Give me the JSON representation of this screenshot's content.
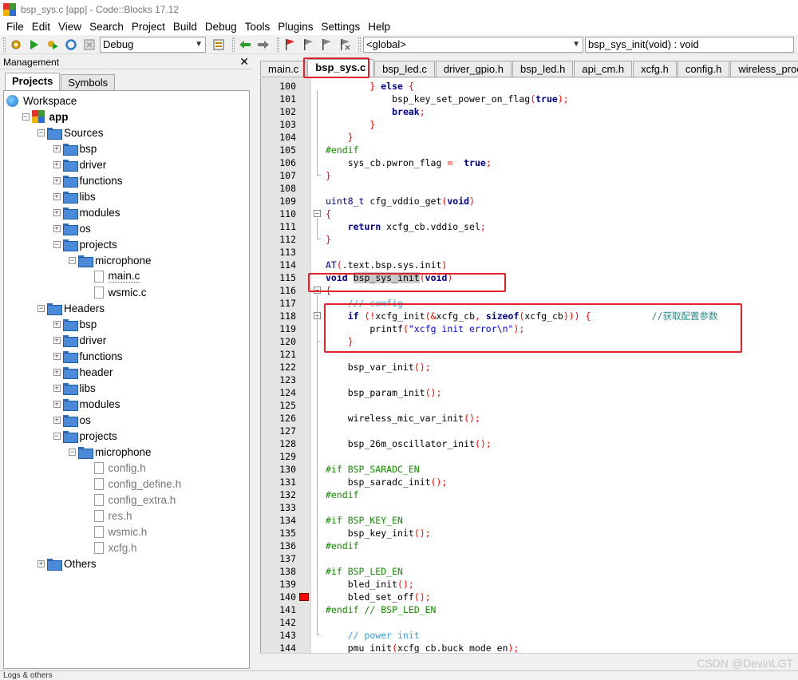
{
  "window": {
    "title": "bsp_sys.c [app] - Code::Blocks 17.12"
  },
  "menu": [
    "File",
    "Edit",
    "View",
    "Search",
    "Project",
    "Build",
    "Debug",
    "Tools",
    "Plugins",
    "Settings",
    "Help"
  ],
  "toolbar": {
    "build_target": "Debug",
    "scope": "<global>",
    "function": "bsp_sys_init(void) : void"
  },
  "management": {
    "title": "Management",
    "tabs": [
      "Projects",
      "Symbols"
    ],
    "tree": [
      {
        "label": "Workspace",
        "indent": 0,
        "icon": "workspace",
        "exp": ""
      },
      {
        "label": "app",
        "indent": 1,
        "icon": "app",
        "exp": "-",
        "bold": true
      },
      {
        "label": "Sources",
        "indent": 2,
        "icon": "folder",
        "exp": "-"
      },
      {
        "label": "bsp",
        "indent": 3,
        "icon": "folder",
        "exp": "+"
      },
      {
        "label": "driver",
        "indent": 3,
        "icon": "folder",
        "exp": "+"
      },
      {
        "label": "functions",
        "indent": 3,
        "icon": "folder",
        "exp": "+"
      },
      {
        "label": "libs",
        "indent": 3,
        "icon": "folder",
        "exp": "+"
      },
      {
        "label": "modules",
        "indent": 3,
        "icon": "folder",
        "exp": "+"
      },
      {
        "label": "os",
        "indent": 3,
        "icon": "folder",
        "exp": "+"
      },
      {
        "label": "projects",
        "indent": 3,
        "icon": "folder",
        "exp": "-"
      },
      {
        "label": "microphone",
        "indent": 4,
        "icon": "folder",
        "exp": "-"
      },
      {
        "label": "main.c",
        "indent": 5,
        "icon": "file",
        "exp": "",
        "selected": true
      },
      {
        "label": "wsmic.c",
        "indent": 5,
        "icon": "file",
        "exp": ""
      },
      {
        "label": "Headers",
        "indent": 2,
        "icon": "folder",
        "exp": "-"
      },
      {
        "label": "bsp",
        "indent": 3,
        "icon": "folder",
        "exp": "+"
      },
      {
        "label": "driver",
        "indent": 3,
        "icon": "folder",
        "exp": "+"
      },
      {
        "label": "functions",
        "indent": 3,
        "icon": "folder",
        "exp": "+"
      },
      {
        "label": "header",
        "indent": 3,
        "icon": "folder",
        "exp": "+"
      },
      {
        "label": "libs",
        "indent": 3,
        "icon": "folder",
        "exp": "+"
      },
      {
        "label": "modules",
        "indent": 3,
        "icon": "folder",
        "exp": "+"
      },
      {
        "label": "os",
        "indent": 3,
        "icon": "folder",
        "exp": "+"
      },
      {
        "label": "projects",
        "indent": 3,
        "icon": "folder",
        "exp": "-"
      },
      {
        "label": "microphone",
        "indent": 4,
        "icon": "folder",
        "exp": "-"
      },
      {
        "label": "config.h",
        "indent": 5,
        "icon": "file",
        "exp": "",
        "gray": true
      },
      {
        "label": "config_define.h",
        "indent": 5,
        "icon": "file",
        "exp": "",
        "gray": true
      },
      {
        "label": "config_extra.h",
        "indent": 5,
        "icon": "file",
        "exp": "",
        "gray": true
      },
      {
        "label": "res.h",
        "indent": 5,
        "icon": "file",
        "exp": "",
        "gray": true
      },
      {
        "label": "wsmic.h",
        "indent": 5,
        "icon": "file",
        "exp": "",
        "gray": true
      },
      {
        "label": "xcfg.h",
        "indent": 5,
        "icon": "file",
        "exp": "",
        "gray": true
      },
      {
        "label": "Others",
        "indent": 2,
        "icon": "folder",
        "exp": "+"
      }
    ]
  },
  "editor": {
    "tabs": [
      "main.c",
      "bsp_sys.c",
      "bsp_led.c",
      "driver_gpio.h",
      "bsp_led.h",
      "api_cm.h",
      "xcfg.h",
      "config.h",
      "wireless_proc.c"
    ],
    "active_tab": 1,
    "lines": [
      {
        "n": "100",
        "t": [
          [
            "op",
            "        } "
          ],
          [
            "kw",
            "else"
          ],
          [
            "op",
            " {"
          ]
        ]
      },
      {
        "n": "101",
        "t": [
          [
            "",
            "            bsp_key_set_power_on_flag"
          ],
          [
            "op",
            "("
          ],
          [
            "kw",
            "true"
          ],
          [
            "op",
            ");"
          ]
        ]
      },
      {
        "n": "102",
        "t": [
          [
            "",
            "            "
          ],
          [
            "kw",
            "break"
          ],
          [
            "op",
            ";"
          ]
        ]
      },
      {
        "n": "103",
        "t": [
          [
            "op",
            "        }"
          ]
        ]
      },
      {
        "n": "104",
        "t": [
          [
            "op",
            "    }"
          ]
        ]
      },
      {
        "n": "105",
        "t": [
          [
            "pp",
            "#endif"
          ]
        ]
      },
      {
        "n": "106",
        "t": [
          [
            "",
            "    sys_cb.pwron_flag "
          ],
          [
            "op",
            "="
          ],
          [
            "",
            "  "
          ],
          [
            "kw",
            "true"
          ],
          [
            "op",
            ";"
          ]
        ]
      },
      {
        "n": "107",
        "t": [
          [
            "op",
            "}"
          ]
        ]
      },
      {
        "n": "108",
        "t": [
          [
            "",
            ""
          ]
        ]
      },
      {
        "n": "109",
        "t": [
          [
            "ty",
            "uint8_t"
          ],
          [
            "",
            " cfg_vddio_get"
          ],
          [
            "op",
            "("
          ],
          [
            "kw",
            "void"
          ],
          [
            "op",
            ")"
          ]
        ]
      },
      {
        "n": "110",
        "t": [
          [
            "op",
            "{"
          ]
        ]
      },
      {
        "n": "111",
        "t": [
          [
            "",
            "    "
          ],
          [
            "kw",
            "return"
          ],
          [
            "",
            " xcfg_cb.vddio_sel"
          ],
          [
            "op",
            ";"
          ]
        ]
      },
      {
        "n": "112",
        "t": [
          [
            "op",
            "}"
          ]
        ]
      },
      {
        "n": "113",
        "t": [
          [
            "",
            ""
          ]
        ]
      },
      {
        "n": "114",
        "t": [
          [
            "ty",
            "AT"
          ],
          [
            "op",
            "("
          ],
          [
            "",
            ".text.bsp.sys.init"
          ],
          [
            "op",
            ")"
          ]
        ]
      },
      {
        "n": "115",
        "t": [
          [
            "kw",
            "void"
          ],
          [
            "",
            " "
          ],
          [
            "hl",
            "bsp_sys_init"
          ],
          [
            "op",
            "("
          ],
          [
            "kw",
            "void"
          ],
          [
            "op",
            ")"
          ]
        ]
      },
      {
        "n": "116",
        "t": [
          [
            "op",
            "{"
          ]
        ]
      },
      {
        "n": "117",
        "t": [
          [
            "cm",
            "    /// config"
          ]
        ]
      },
      {
        "n": "118",
        "t": [
          [
            "",
            "    "
          ],
          [
            "kw",
            "if"
          ],
          [
            "",
            " "
          ],
          [
            "op",
            "(!"
          ],
          [
            "",
            "xcfg_init"
          ],
          [
            "op",
            "(&"
          ],
          [
            "",
            "xcfg_cb"
          ],
          [
            "op",
            ", "
          ],
          [
            "kw",
            "sizeof"
          ],
          [
            "op",
            "("
          ],
          [
            "",
            "xcfg_cb"
          ],
          [
            "op",
            ")))"
          ],
          [
            "op",
            " {"
          ],
          [
            "",
            "           "
          ],
          [
            "cmcn",
            "//获取配置参数"
          ]
        ]
      },
      {
        "n": "119",
        "t": [
          [
            "",
            "        printf"
          ],
          [
            "op",
            "("
          ],
          [
            "st",
            "\"xcfg init error\\n\""
          ],
          [
            "op",
            ");"
          ]
        ]
      },
      {
        "n": "120",
        "t": [
          [
            "op",
            "    }"
          ]
        ]
      },
      {
        "n": "121",
        "t": [
          [
            "",
            ""
          ]
        ]
      },
      {
        "n": "122",
        "t": [
          [
            "",
            "    bsp_var_init"
          ],
          [
            "op",
            "();"
          ]
        ]
      },
      {
        "n": "123",
        "t": [
          [
            "",
            ""
          ]
        ]
      },
      {
        "n": "124",
        "t": [
          [
            "",
            "    bsp_param_init"
          ],
          [
            "op",
            "();"
          ]
        ]
      },
      {
        "n": "125",
        "t": [
          [
            "",
            ""
          ]
        ]
      },
      {
        "n": "126",
        "t": [
          [
            "",
            "    wireless_mic_var_init"
          ],
          [
            "op",
            "();"
          ]
        ]
      },
      {
        "n": "127",
        "t": [
          [
            "",
            ""
          ]
        ]
      },
      {
        "n": "128",
        "t": [
          [
            "",
            "    bsp_26m_oscillator_init"
          ],
          [
            "op",
            "();"
          ]
        ]
      },
      {
        "n": "129",
        "t": [
          [
            "",
            ""
          ]
        ]
      },
      {
        "n": "130",
        "t": [
          [
            "pp",
            "#if BSP_SARADC_EN"
          ]
        ]
      },
      {
        "n": "131",
        "t": [
          [
            "",
            "    bsp_saradc_init"
          ],
          [
            "op",
            "();"
          ]
        ]
      },
      {
        "n": "132",
        "t": [
          [
            "pp",
            "#endif"
          ]
        ]
      },
      {
        "n": "133",
        "t": [
          [
            "",
            ""
          ]
        ]
      },
      {
        "n": "134",
        "t": [
          [
            "pp",
            "#if BSP_KEY_EN"
          ]
        ]
      },
      {
        "n": "135",
        "t": [
          [
            "",
            "    bsp_key_init"
          ],
          [
            "op",
            "();"
          ]
        ]
      },
      {
        "n": "136",
        "t": [
          [
            "pp",
            "#endif"
          ]
        ]
      },
      {
        "n": "137",
        "t": [
          [
            "",
            ""
          ]
        ]
      },
      {
        "n": "138",
        "t": [
          [
            "pp",
            "#if BSP_LED_EN"
          ]
        ]
      },
      {
        "n": "139",
        "t": [
          [
            "",
            "    bled_init"
          ],
          [
            "op",
            "();"
          ]
        ]
      },
      {
        "n": "140",
        "t": [
          [
            "",
            "    bled_set_off"
          ],
          [
            "op",
            "();"
          ]
        ],
        "breakpoint": true
      },
      {
        "n": "141",
        "t": [
          [
            "pp",
            "#endif // BSP_LED_EN"
          ]
        ]
      },
      {
        "n": "142",
        "t": [
          [
            "",
            ""
          ]
        ]
      },
      {
        "n": "143",
        "t": [
          [
            "cm",
            "    // power init"
          ]
        ]
      },
      {
        "n": "144",
        "t": [
          [
            "",
            "    pmu_init"
          ],
          [
            "op",
            "("
          ],
          [
            "",
            "xcfg_cb.buck_mode_en"
          ],
          [
            "op",
            ");"
          ]
        ]
      }
    ]
  },
  "status": {
    "text": "Logs & others"
  },
  "watermark": "CSDN @DevinLGT"
}
